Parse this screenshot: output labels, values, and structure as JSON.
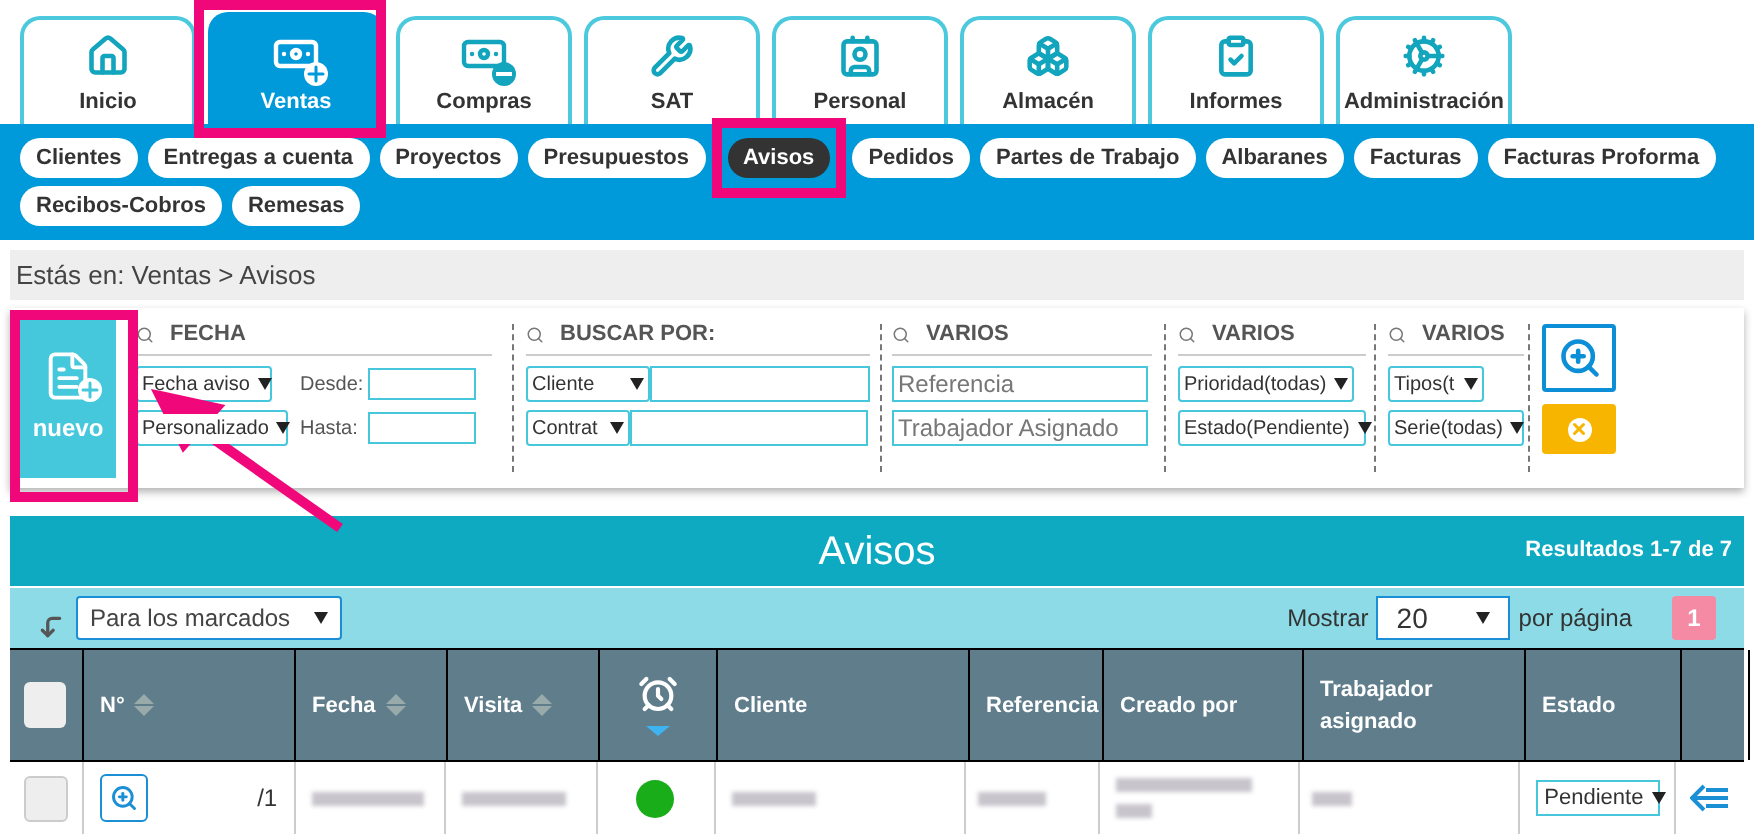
{
  "main_tabs": [
    {
      "label": "Inicio",
      "selected": false
    },
    {
      "label": "Ventas",
      "selected": true
    },
    {
      "label": "Compras",
      "selected": false
    },
    {
      "label": "SAT",
      "selected": false
    },
    {
      "label": "Personal",
      "selected": false
    },
    {
      "label": "Almacén",
      "selected": false
    },
    {
      "label": "Informes",
      "selected": false
    },
    {
      "label": "Administración",
      "selected": false
    }
  ],
  "sub_tabs": [
    {
      "label": "Clientes",
      "selected": false
    },
    {
      "label": "Entregas a cuenta",
      "selected": false
    },
    {
      "label": "Proyectos",
      "selected": false
    },
    {
      "label": "Presupuestos",
      "selected": false
    },
    {
      "label": "Avisos",
      "selected": true
    },
    {
      "label": "Pedidos",
      "selected": false
    },
    {
      "label": "Partes de Trabajo",
      "selected": false
    },
    {
      "label": "Albaranes",
      "selected": false
    },
    {
      "label": "Facturas",
      "selected": false
    },
    {
      "label": "Facturas Proforma",
      "selected": false
    },
    {
      "label": "Recibos-Cobros",
      "selected": false
    },
    {
      "label": "Remesas",
      "selected": false
    }
  ],
  "breadcrumb": "Estás en: Ventas > Avisos",
  "new_button": {
    "label": "nuevo"
  },
  "filters": {
    "fecha": {
      "title": "FECHA",
      "date_type": "Fecha aviso",
      "range": "Personalizado",
      "from_label": "Desde:",
      "to_label": "Hasta:"
    },
    "buscar": {
      "title": "BUSCAR POR:",
      "field_1": "Cliente",
      "field_2": "Contrat"
    },
    "varios_1": {
      "title": "VARIOS",
      "placeholder_1": "Referencia",
      "placeholder_2": "Trabajador Asignado"
    },
    "varios_2": {
      "title": "VARIOS",
      "select_1": "Prioridad(todas)",
      "select_2": "Estado(Pendiente)"
    },
    "varios_3": {
      "title": "VARIOS",
      "select_1": "Tipos(t",
      "select_2": "Serie(todas)"
    }
  },
  "list": {
    "title": "Avisos",
    "results": "Resultados 1-7 de 7",
    "bulk_action": "Para los marcados",
    "show_label": "Mostrar",
    "page_size": "20",
    "per_page_label": "por página",
    "pages": [
      {
        "label": "1",
        "selected": true
      }
    ],
    "columns": [
      {
        "kind": "checkbox",
        "checked": false
      },
      {
        "kind": "text",
        "label": "N°",
        "sortable": true
      },
      {
        "kind": "text",
        "label": "Fecha",
        "sortable": true
      },
      {
        "kind": "text",
        "label": "Visita",
        "sortable": true
      },
      {
        "kind": "alarm"
      },
      {
        "kind": "text",
        "label": "Cliente",
        "sortable": false
      },
      {
        "kind": "text",
        "label": "Referencia",
        "sortable": false
      },
      {
        "kind": "text",
        "label": "Creado por",
        "sortable": false
      },
      {
        "kind": "text",
        "label": "Trabajador asignado",
        "sortable": false
      },
      {
        "kind": "text",
        "label": "Estado",
        "sortable": false
      },
      {
        "kind": "blank"
      }
    ],
    "rows": [
      {
        "checked": false,
        "number": "/1",
        "color": "#1aad1a",
        "estado": "Pendiente"
      }
    ]
  }
}
